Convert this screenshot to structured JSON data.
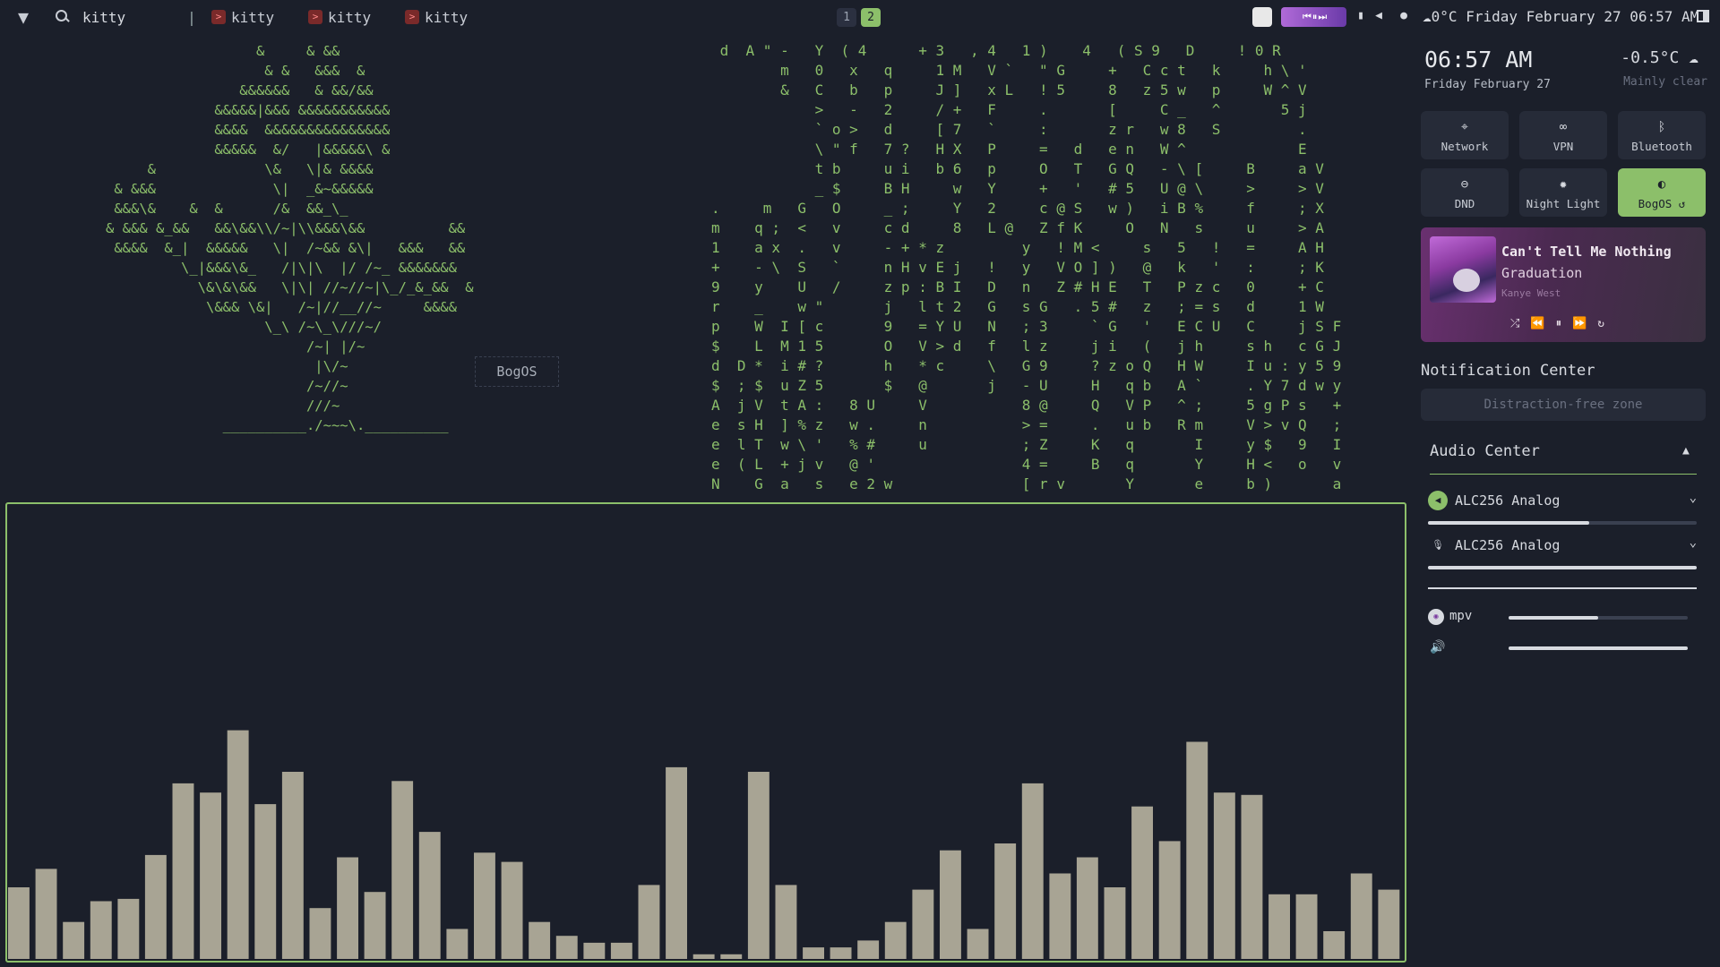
{
  "topbar": {
    "active_title": "kitty",
    "separator": "|",
    "tasks": [
      "kitty",
      "kitty",
      "kitty"
    ],
    "workspaces": [
      "1",
      "2"
    ],
    "active_workspace": "2",
    "weather_temp": "0°C",
    "datetime": "Friday February 27 06:57 AM"
  },
  "terminal_tag": "BogOS",
  "sidebar": {
    "time": "06:57 AM",
    "date": "Friday February 27",
    "temperature": "-0.5°C",
    "condition": "Mainly clear",
    "toggles": [
      {
        "label": "Network",
        "icon": "network-icon",
        "active": false
      },
      {
        "label": "VPN",
        "icon": "vpn-icon",
        "active": false
      },
      {
        "label": "Bluetooth",
        "icon": "bluetooth-icon",
        "active": false
      },
      {
        "label": "DND",
        "icon": "dnd-icon",
        "active": false
      },
      {
        "label": "Night Light",
        "icon": "night-light-icon",
        "active": false
      },
      {
        "label": "BogOS ↺",
        "icon": "theme-icon",
        "active": true
      }
    ],
    "media": {
      "title": "Can't Tell Me Nothing",
      "album": "Graduation",
      "artist": "Kanye West"
    },
    "notification_center": "Notification Center",
    "notification_placeholder": "Distraction-free zone",
    "audio_center": "Audio Center",
    "audio_devices": [
      {
        "name": "ALC256 Analog",
        "level": 0.6
      },
      {
        "name": "ALC256 Analog",
        "level": 1.0
      }
    ],
    "app_streams": [
      {
        "name": "mpv",
        "level": 0.5
      },
      {
        "name": "",
        "level": 1.0
      }
    ]
  },
  "visualizer": {
    "bar_color": "#a8a494",
    "levels": [
      0.31,
      0.39,
      0.16,
      0.25,
      0.26,
      0.45,
      0.76,
      0.72,
      0.99,
      0.67,
      0.81,
      0.22,
      0.44,
      0.29,
      0.77,
      0.55,
      0.13,
      0.46,
      0.42,
      0.16,
      0.1,
      0.07,
      0.07,
      0.32,
      0.83,
      0.02,
      0.02,
      0.81,
      0.32,
      0.05,
      0.05,
      0.08,
      0.16,
      0.3,
      0.47,
      0.13,
      0.5,
      0.76,
      0.37,
      0.44,
      0.31,
      0.66,
      0.51,
      0.94,
      0.72,
      0.71,
      0.28,
      0.28,
      0.12,
      0.37,
      0.3
    ]
  },
  "colors": {
    "accent": "#8cbf6a",
    "background": "#1b1f2a",
    "tile": "#262b38"
  }
}
